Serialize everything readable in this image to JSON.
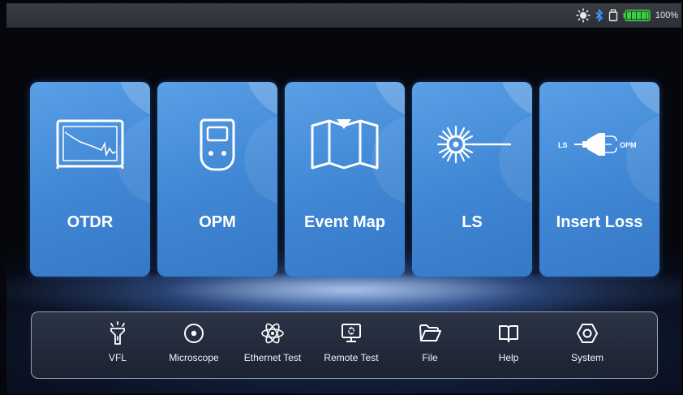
{
  "status_bar": {
    "icons": [
      "sun-brightness-icon",
      "bluetooth-icon",
      "usb-storage-icon",
      "battery-icon"
    ],
    "battery_level": 1.0,
    "battery_text": "100%",
    "colors": {
      "sun": "#e8e8e8",
      "bluetooth": "#3a9bff",
      "battery_fill": "#35d23a"
    }
  },
  "tiles": [
    {
      "label": "OTDR",
      "icon": "otdr-screen-icon"
    },
    {
      "label": "OPM",
      "icon": "power-meter-icon"
    },
    {
      "label": "Event Map",
      "icon": "map-marker-icon"
    },
    {
      "label": "LS",
      "icon": "laser-source-icon"
    },
    {
      "label": "Insert Loss",
      "icon": "insert-loss-icon",
      "icon_text": {
        "left": "LS",
        "right": "OPM"
      }
    }
  ],
  "dock": {
    "items": [
      {
        "label": "VFL",
        "icon": "flashlight-icon"
      },
      {
        "label": "Microscope",
        "icon": "target-circle-icon"
      },
      {
        "label": "Ethernet Test",
        "icon": "atom-icon"
      },
      {
        "label": "Remote Test",
        "icon": "monitor-icon"
      },
      {
        "label": "File",
        "icon": "folder-icon"
      },
      {
        "label": "Help",
        "icon": "book-icon"
      },
      {
        "label": "System",
        "icon": "settings-hex-icon"
      }
    ]
  },
  "colors": {
    "tile": "#4a90dc",
    "dock_border": "#9aa3b5",
    "text": "#ffffff"
  }
}
